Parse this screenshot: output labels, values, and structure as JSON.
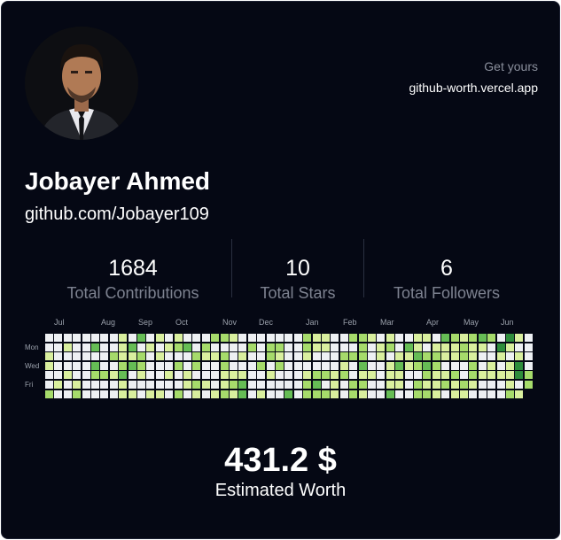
{
  "promo": {
    "label": "Get yours",
    "link": "github-worth.vercel.app"
  },
  "user": {
    "name": "Jobayer Ahmed",
    "profile": "github.com/Jobayer109"
  },
  "stats": [
    {
      "value": "1684",
      "label": "Total Contributions"
    },
    {
      "value": "10",
      "label": "Total Stars"
    },
    {
      "value": "6",
      "label": "Total Followers"
    }
  ],
  "calendar": {
    "months": [
      "Jul",
      "Aug",
      "Sep",
      "Oct",
      "Nov",
      "Dec",
      "Jan",
      "Feb",
      "Mar",
      "Apr",
      "May",
      "Jun"
    ],
    "days": [
      "Mon",
      "Wed",
      "Fri"
    ],
    "levels": [
      "#eef0f3",
      "#d9ef9e",
      "#a6db6b",
      "#66bd55",
      "#2e8d3b"
    ]
  },
  "worth": {
    "value": "431.2 $",
    "label": "Estimated Worth"
  }
}
